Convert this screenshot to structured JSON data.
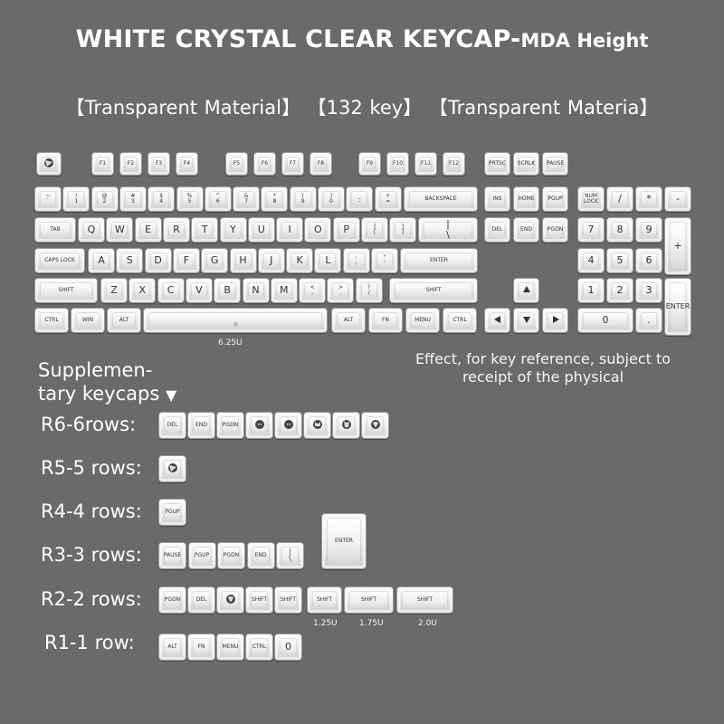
{
  "title": {
    "main": "WHITE CRYSTAL CLEAR KEYCAP-",
    "sub": "MDA Height"
  },
  "subtitle": "【Transparent Material】 【132 key】 【Transparent Materia】",
  "spacebar_size": "6.25U",
  "effect_note": "Effect, for key reference, subject to receipt of the physical",
  "supplementary": {
    "line1": "Supplemen-",
    "line2": "tary keycaps",
    "arrow": "▼"
  },
  "rows": {
    "r6": "R6-6rows:",
    "r5": "R5-5 rows:",
    "r4": "R4-4 rows:",
    "r3": "R3-3 rows:",
    "r2": "R2-2 rows:",
    "r1": "R1-1 row:"
  },
  "sizes": {
    "s125": "1.25U",
    "s175": "1.75U",
    "s200": "2.0U"
  },
  "colors": {
    "background": "#6a6a6a",
    "keycap": "#eeeeee",
    "legend": "#333333"
  },
  "keys": {
    "fn_row": [
      "F1",
      "F2",
      "F3",
      "F4",
      "F5",
      "F6",
      "F7",
      "F8",
      "F9",
      "F10",
      "F11",
      "F12"
    ],
    "nav_top": [
      "PRTSC",
      "SCRLK",
      "PAUSE"
    ],
    "number_row": [
      "~\n`",
      "!\n1",
      "@\n2",
      "#\n3",
      "$\n4",
      "%\n5",
      "^\n6",
      "&\n7",
      "*\n8",
      "(\n9",
      ")\n0",
      "_\n-",
      "+\n="
    ],
    "backspace": "BACKSPACE",
    "nav_mid": [
      "INS",
      "HOME",
      "PGUP"
    ],
    "nav_bot": [
      "DEL",
      "END",
      "PGDN"
    ],
    "numpad_top": [
      "NUM\nLOCK",
      "/",
      "*",
      "-"
    ],
    "tab": "TAB",
    "qrow": [
      "Q",
      "W",
      "E",
      "R",
      "T",
      "Y",
      "U",
      "I",
      "O",
      "P",
      "{\n[",
      "}\n]",
      "|\n\\"
    ],
    "caps": "CAPS LOCK",
    "arow": [
      "A",
      "S",
      "D",
      "F",
      "G",
      "H",
      "J",
      "K",
      "L",
      ":\n;",
      "\"\n'"
    ],
    "enter": "ENTER",
    "shift": "SHIFT",
    "zrow": [
      "Z",
      "X",
      "C",
      "V",
      "B",
      "N",
      "M",
      "<\n,",
      ">\n.",
      "?\n/"
    ],
    "mods_left": [
      "CTRL",
      "WIN",
      "ALT"
    ],
    "mods_right": [
      "ALT",
      "FN",
      "MENU",
      "CTRL"
    ],
    "numpad": [
      "7",
      "8",
      "9",
      "+",
      "4",
      "5",
      "6",
      "1",
      "2",
      "3",
      "ENTER",
      "0",
      "."
    ],
    "supp_r6": [
      "DEL",
      "END",
      "PGDN"
    ],
    "supp_r4": [
      "PGUP"
    ],
    "supp_r3": [
      "PAUSE",
      "PGUP",
      "PGDN",
      "END",
      "|\n\\"
    ],
    "supp_r3_enter": "ENTER",
    "supp_r2": [
      "PGDN",
      "DEL",
      "SHIFT",
      "SHIFT",
      "SHIFT",
      "SHIFT",
      "SHIFT"
    ],
    "supp_r1": [
      "ALT",
      "FN",
      "MENU",
      "CTRL",
      "0"
    ]
  }
}
